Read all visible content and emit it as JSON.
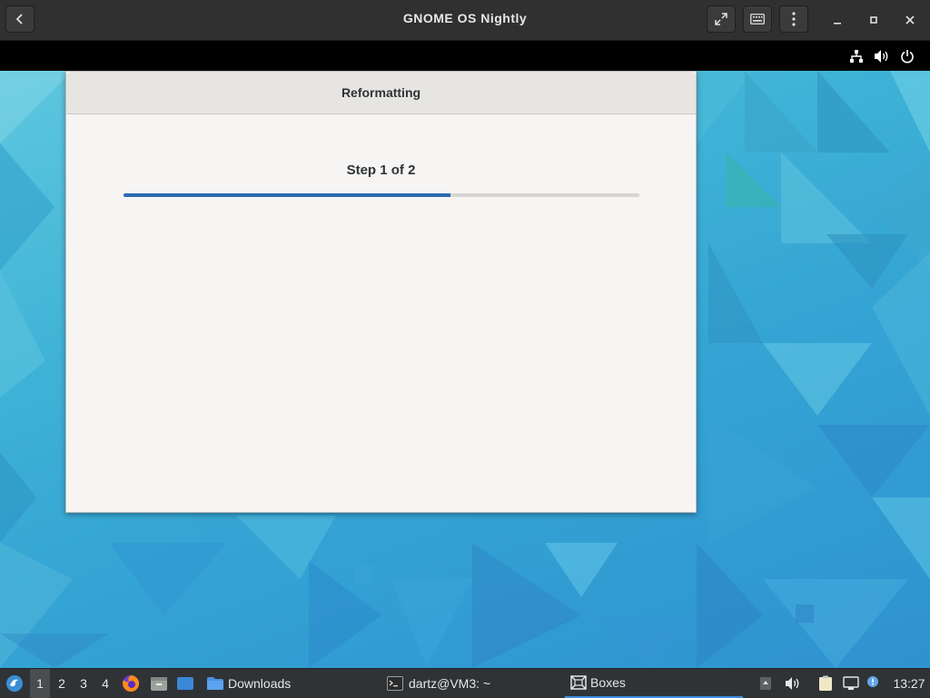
{
  "boxes_header": {
    "title": "GNOME OS Nightly",
    "back_icon": "chevron-left-icon",
    "fullscreen_icon": "fullscreen-icon",
    "keyboard_icon": "keyboard-icon",
    "menu_icon": "kebab-menu-icon",
    "minimize_icon": "minimize-icon",
    "maximize_icon": "maximize-icon",
    "close_icon": "close-icon"
  },
  "guest_topbar": {
    "tray": [
      "network-icon",
      "volume-icon",
      "power-icon"
    ]
  },
  "dialog": {
    "title": "Reformatting",
    "step_label": "Step 1 of 2",
    "progress": 0.634
  },
  "taskbar": {
    "workspaces": [
      "1",
      "2",
      "3",
      "4"
    ],
    "active_workspace": "1",
    "tasks": {
      "downloads": "Downloads",
      "terminal": "dartz@VM3: ~",
      "boxes": "Boxes"
    },
    "clock": "13:27"
  },
  "colors": {
    "accent": "#3584e4",
    "header_bg": "#303030",
    "taskbar_bg": "#303336"
  }
}
